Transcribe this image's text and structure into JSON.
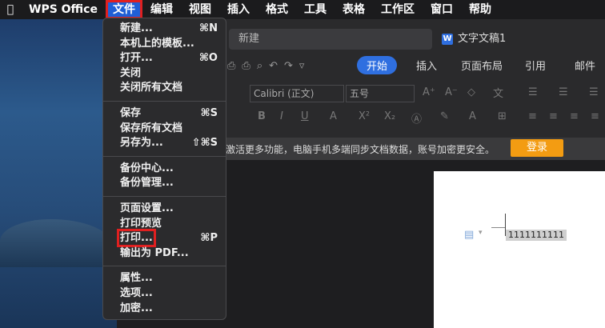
{
  "menubar": {
    "apple_icon": "",
    "app_name": "WPS Office",
    "items": [
      "文件",
      "编辑",
      "视图",
      "插入",
      "格式",
      "工具",
      "表格",
      "工作区",
      "窗口",
      "帮助"
    ],
    "active_index": 0
  },
  "file_menu": {
    "groups": [
      [
        {
          "label": "新建...",
          "shortcut": "⌘N"
        },
        {
          "label": "本机上的模板...",
          "shortcut": ""
        },
        {
          "label": "打开...",
          "shortcut": "⌘O"
        },
        {
          "label": "关闭",
          "shortcut": ""
        },
        {
          "label": "关闭所有文档",
          "shortcut": ""
        }
      ],
      [
        {
          "label": "保存",
          "shortcut": "⌘S"
        },
        {
          "label": "保存所有文档",
          "shortcut": ""
        },
        {
          "label": "另存为...",
          "shortcut": "⇧⌘S"
        }
      ],
      [
        {
          "label": "备份中心...",
          "shortcut": ""
        },
        {
          "label": "备份管理...",
          "shortcut": ""
        }
      ],
      [
        {
          "label": "页面设置...",
          "shortcut": ""
        },
        {
          "label": "打印预览",
          "shortcut": ""
        },
        {
          "label": "打印...",
          "shortcut": "⌘P",
          "highlighted": true
        },
        {
          "label": "输出为 PDF...",
          "shortcut": ""
        }
      ],
      [
        {
          "label": "属性...",
          "shortcut": ""
        },
        {
          "label": "选项...",
          "shortcut": ""
        },
        {
          "label": "加密...",
          "shortcut": ""
        }
      ]
    ]
  },
  "tabs": {
    "new_tab": "新建",
    "doc_tab": "文字文稿1",
    "doc_icon": "W"
  },
  "ribbon": {
    "tabs": [
      "开始",
      "插入",
      "页面布局",
      "引用",
      "邮件"
    ],
    "active_tab": "开始",
    "font_name": "Calibri (正文)",
    "font_size": "五号",
    "format_glyphs": [
      "B",
      "I",
      "U",
      "A",
      "X²",
      "X₂"
    ]
  },
  "notice": {
    "text": "激活更多功能，电脑手机多端同步文档数据，账号加密更安全。",
    "login_label": "登录"
  },
  "document": {
    "content": "1111111111"
  },
  "colors": {
    "accent": "#2f6fe0",
    "highlight_box": "#e02020",
    "login": "#f39c12"
  }
}
